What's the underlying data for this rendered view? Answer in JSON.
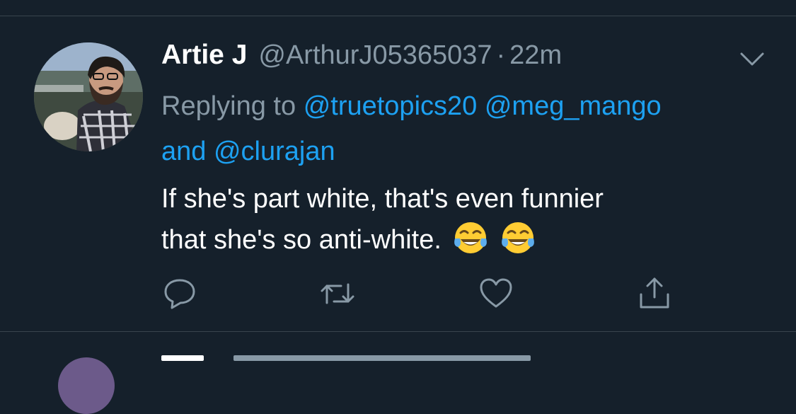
{
  "tweet": {
    "author_name": "Artie J",
    "handle": "@ArthurJ05365037",
    "separator": "·",
    "time": "22m",
    "replying_prefix": "Replying to",
    "mentions": [
      "@truetopics20",
      "@meg_mango"
    ],
    "mention_joiner": "and",
    "last_mention": "@clurajan",
    "text_line1": "If she's part white, that's even funnier",
    "text_line2": "that she's so anti-white.",
    "emojis": [
      "face-with-tears-of-joy",
      "face-with-tears-of-joy"
    ]
  },
  "actions": {
    "reply_icon": "speech-bubble-icon",
    "retweet_icon": "retweet-arrows-icon",
    "like_icon": "heart-icon",
    "share_icon": "share-upload-icon"
  },
  "colors": {
    "background": "#15202b",
    "text": "#ffffff",
    "muted": "#8899a6",
    "link": "#1da1f2",
    "divider": "#38444d"
  }
}
